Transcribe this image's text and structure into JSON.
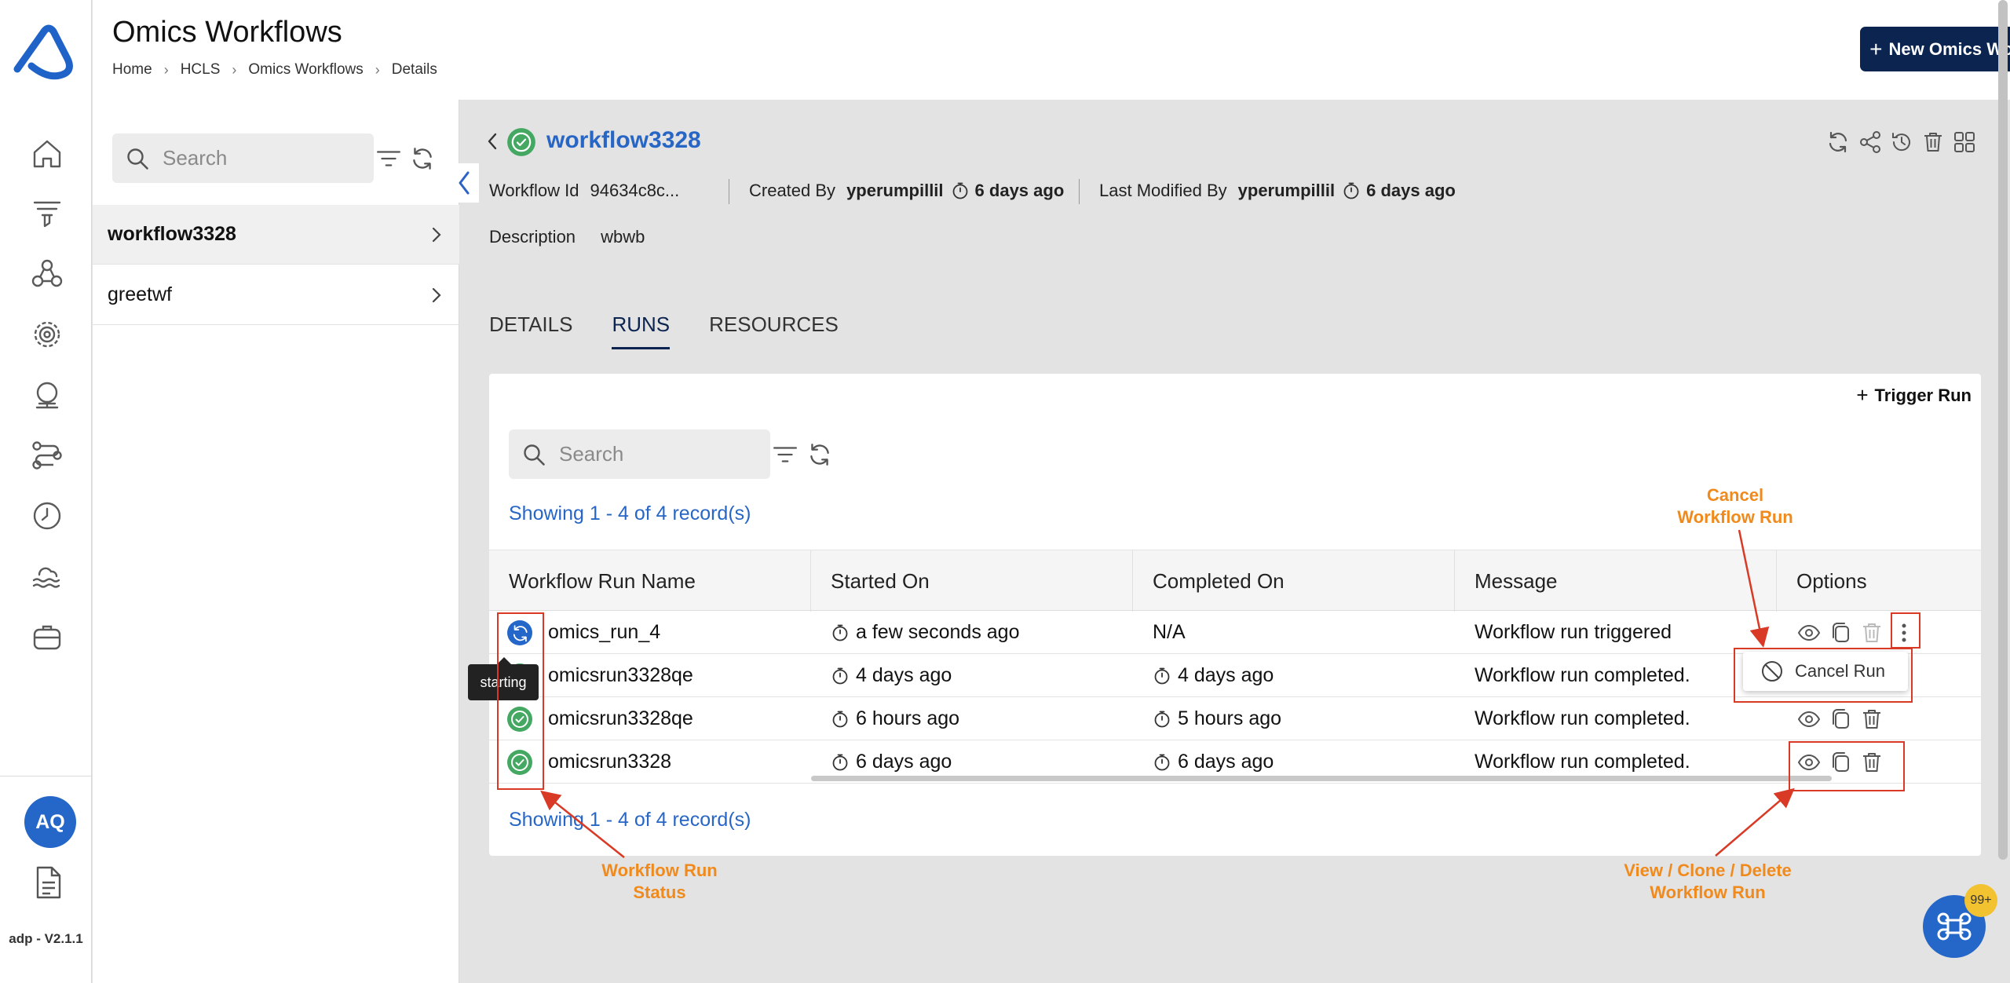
{
  "app": {
    "title": "Omics Workflows",
    "version": "adp - V2.1.1",
    "avatar_initials": "AQ",
    "brand_color": "#2566c9",
    "primary_dark": "#0b2450",
    "annotation_color": "#f08a1c"
  },
  "breadcrumb": [
    "Home",
    "HCLS",
    "Omics Workflows",
    "Details"
  ],
  "header": {
    "new_button": "New Omics Workflow"
  },
  "nav_icons": [
    "home-icon",
    "filter-funnel-icon",
    "network-icon",
    "settings-cog-icon",
    "globe-stand-icon",
    "pipeline-icon",
    "clock-icon",
    "cloud-waves-icon",
    "storage-box-icon"
  ],
  "list": {
    "search_placeholder": "Search",
    "items": [
      {
        "name": "workflow3328",
        "selected": true
      },
      {
        "name": "greetwf",
        "selected": false
      }
    ]
  },
  "detail": {
    "name": "workflow3328",
    "workflow_id_label": "Workflow Id",
    "workflow_id": "94634c8c...",
    "created_by_label": "Created By",
    "created_by": "yperumpillil",
    "created_ago": "6 days ago",
    "modified_by_label": "Last Modified By",
    "modified_by": "yperumpillil",
    "modified_ago": "6 days ago",
    "description_label": "Description",
    "description": "wbwb"
  },
  "tabs": [
    "DETAILS",
    "RUNS",
    "RESOURCES"
  ],
  "active_tab": "RUNS",
  "runs": {
    "trigger_label": "Trigger Run",
    "search_placeholder": "Search",
    "showing_top": "Showing 1 - 4 of 4 record(s)",
    "showing_bottom": "Showing 1 - 4 of 4 record(s)",
    "columns": [
      "Workflow Run Name",
      "Started On",
      "Completed On",
      "Message",
      "Options"
    ],
    "rows": [
      {
        "status": "starting",
        "name": "omics_run_4",
        "started": "a few seconds ago",
        "completed": "N/A",
        "message": "Workflow run triggered"
      },
      {
        "status": "completed",
        "name": "omicsrun3328qe",
        "started": "4 days ago",
        "completed": "4 days ago",
        "message": "Workflow run completed."
      },
      {
        "status": "completed",
        "name": "omicsrun3328qe",
        "started": "6 hours ago",
        "completed": "5 hours ago",
        "message": "Workflow run completed."
      },
      {
        "status": "completed",
        "name": "omicsrun3328",
        "started": "6 days ago",
        "completed": "6 days ago",
        "message": "Workflow run completed."
      }
    ],
    "tooltip": "starting",
    "menu_item": "Cancel Run"
  },
  "annotations": {
    "cancel_line1": "Cancel",
    "cancel_line2": "Workflow Run",
    "status_line1": "Workflow Run",
    "status_line2": "Status",
    "actions_line1": "View / Clone / Delete",
    "actions_line2": "Workflow Run"
  },
  "fab_badge": "99+"
}
